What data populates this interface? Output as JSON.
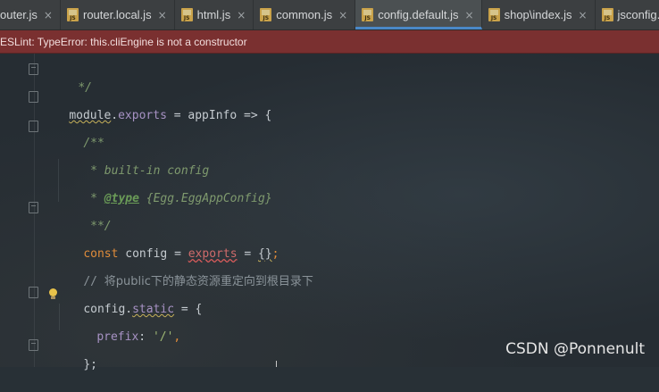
{
  "tabs": [
    {
      "label": "outer.js",
      "active": false,
      "has_icon": false
    },
    {
      "label": "router.local.js",
      "active": false,
      "has_icon": true
    },
    {
      "label": "html.js",
      "active": false,
      "has_icon": true
    },
    {
      "label": "common.js",
      "active": false,
      "has_icon": true
    },
    {
      "label": "config.default.js",
      "active": true,
      "has_icon": true
    },
    {
      "label": "shop\\index.js",
      "active": false,
      "has_icon": true
    },
    {
      "label": "jsconfig.j",
      "active": false,
      "has_icon": true
    }
  ],
  "tab_icon_text": "JS",
  "tab_close_glyph": "×",
  "eslint_message": "ESLint: TypeError: this.cliEngine is not a constructor",
  "code": {
    "l1": "*/",
    "l2_module": "module",
    "l2_dot": ".",
    "l2_exports": "exports",
    "l2_rest": " = appInfo => {",
    "l3": "/**",
    "l4": " * built-in config",
    "l5_star": " * ",
    "l5_tag": "@type",
    "l5_type": " {Egg.EggAppConfig}",
    "l6": " **/",
    "l7_const": "const",
    "l7_config": " config = ",
    "l7_exports": "exports",
    "l7_eq": " = ",
    "l7_obj": "{}",
    "l7_semi": ";",
    "l8_slashes": "// ",
    "l8_text": "将public下的静态资源重定向到根目录下",
    "l9_config": "config.",
    "l9_static": "static",
    "l9_rest": " = {",
    "l10_prefix": "prefix",
    "l10_colon": ": ",
    "l10_value": "'/'",
    "l10_comma": ",",
    "l11": "};"
  },
  "watermark": "CSDN @Ponnenult",
  "colors": {
    "editor_bg": "#262d33",
    "tabbar_bg": "#3c3f41",
    "active_tab_underline": "#4a88c7",
    "eslint_bg": "#7a3030",
    "keyword": "#e08c3a",
    "property": "#a792c4",
    "comment": "#7f9a6e"
  }
}
